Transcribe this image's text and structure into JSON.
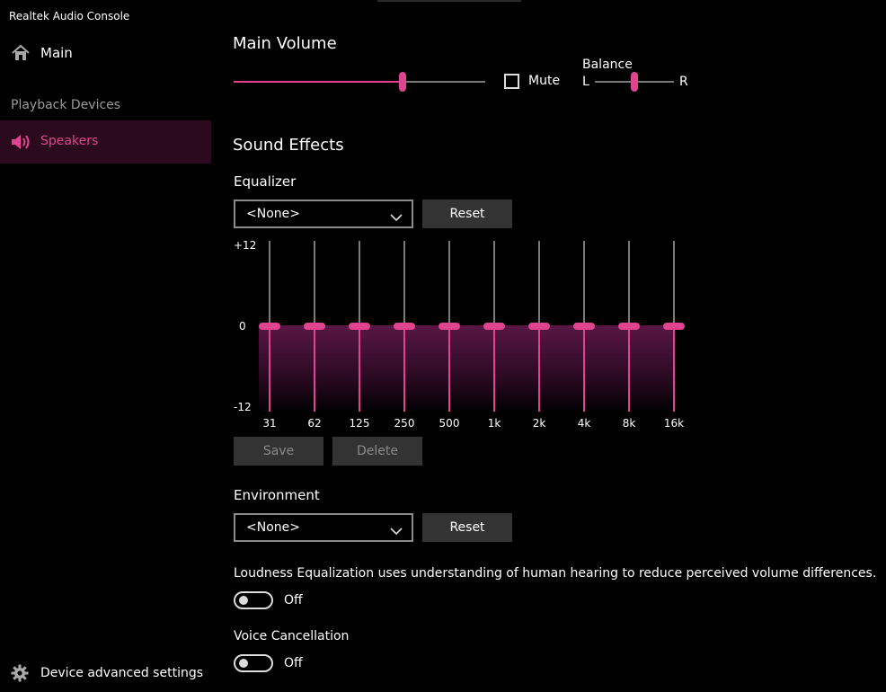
{
  "app": {
    "title": "Realtek Audio Console"
  },
  "sidebar": {
    "main_label": "Main",
    "section_label": "Playback Devices",
    "device_label": "Speakers",
    "advanced_label": "Device advanced settings"
  },
  "main_volume": {
    "heading": "Main Volume",
    "volume_level": 0.67,
    "mute_label": "Mute",
    "mute_checked": false,
    "balance_label": "Balance",
    "balance_left": "L",
    "balance_right": "R",
    "balance_level": 0.5
  },
  "sound_effects": {
    "heading": "Sound Effects",
    "equalizer": {
      "label": "Equalizer",
      "preset": "<None>",
      "reset_label": "Reset",
      "scale_top": "+12",
      "scale_mid": "0",
      "scale_bottom": "-12",
      "bands": [
        {
          "freq": "31",
          "gain": 0
        },
        {
          "freq": "62",
          "gain": 0
        },
        {
          "freq": "125",
          "gain": 0
        },
        {
          "freq": "250",
          "gain": 0
        },
        {
          "freq": "500",
          "gain": 0
        },
        {
          "freq": "1k",
          "gain": 0
        },
        {
          "freq": "2k",
          "gain": 0
        },
        {
          "freq": "4k",
          "gain": 0
        },
        {
          "freq": "8k",
          "gain": 0
        },
        {
          "freq": "16k",
          "gain": 0
        }
      ],
      "save_label": "Save",
      "delete_label": "Delete"
    },
    "environment": {
      "label": "Environment",
      "preset": "<None>",
      "reset_label": "Reset"
    },
    "loudness": {
      "description": "Loudness Equalization uses understanding of human hearing to reduce perceived volume differences.",
      "state": "Off"
    },
    "voice_cancellation": {
      "label": "Voice Cancellation",
      "state": "Off"
    }
  },
  "colors": {
    "accent": "#e0448f",
    "selected_bg": "#2b0a1e",
    "background": "#000000"
  },
  "icons": {
    "main": "home-icon",
    "speakers": "speaker-icon",
    "advanced": "gear-icon",
    "dropdown": "chevron-down-icon"
  }
}
